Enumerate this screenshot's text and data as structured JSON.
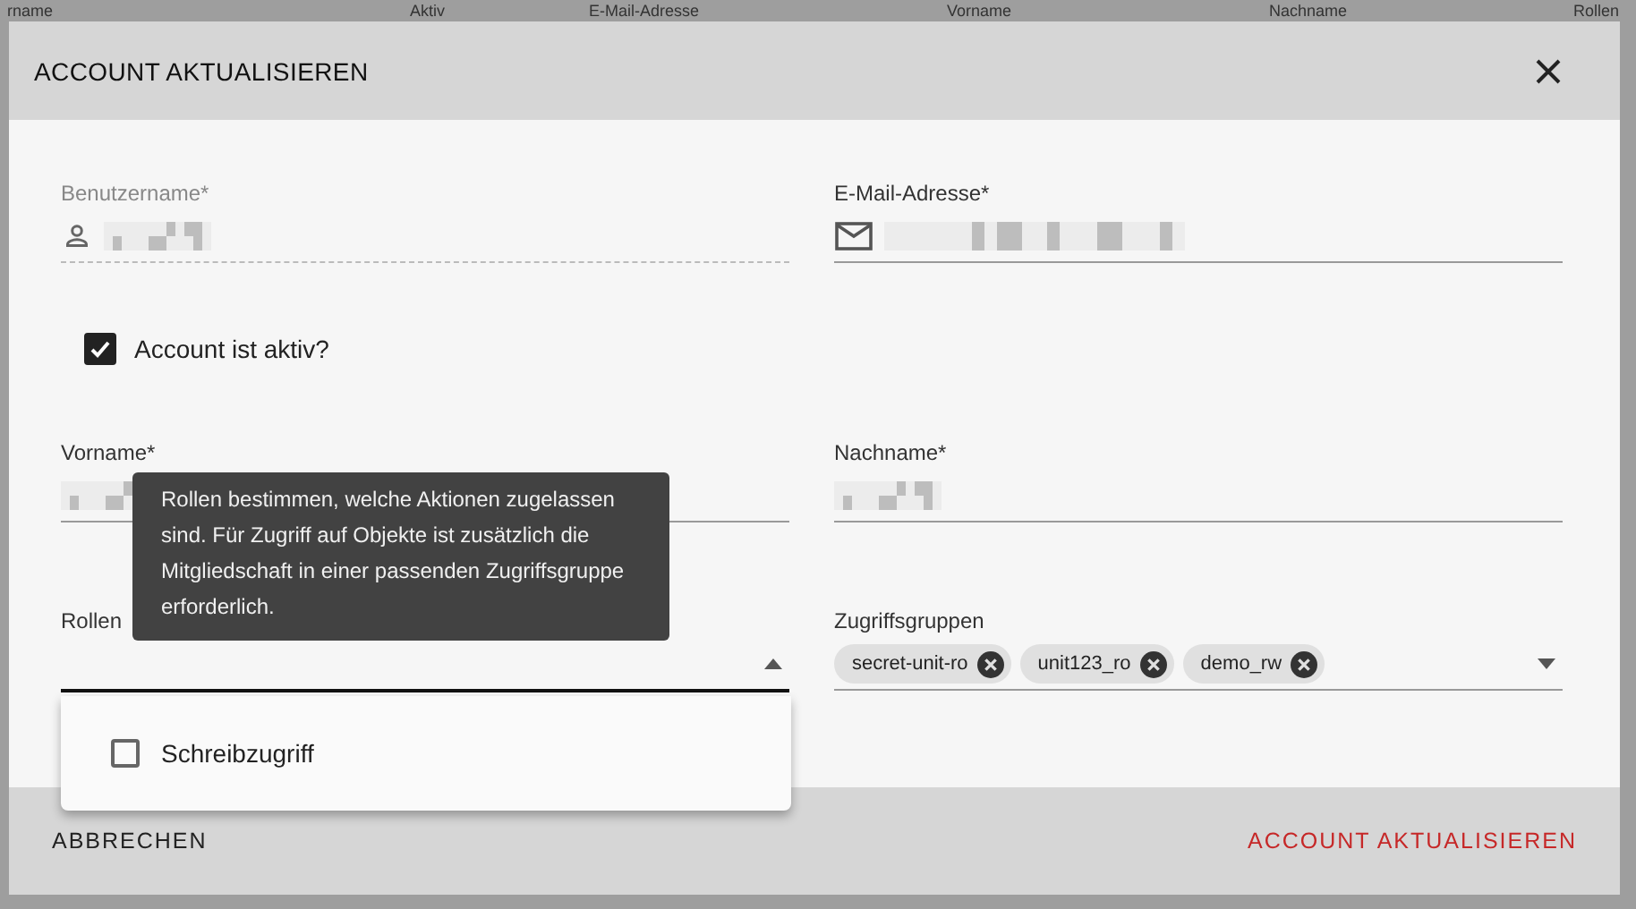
{
  "background_table": {
    "columns": [
      "rname",
      "Aktiv",
      "E-Mail-Adresse",
      "Vorname",
      "Nachname",
      "Rollen"
    ]
  },
  "dialog": {
    "title": "ACCOUNT AKTUALISIEREN",
    "rows": [
      {
        "fields": [
          {
            "kind": "user",
            "label": "Benutzername*",
            "disabled": true,
            "redacted": true
          },
          {
            "kind": "email",
            "label": "E-Mail-Adresse*",
            "disabled": false,
            "redacted": true
          }
        ]
      },
      {
        "checkbox": {
          "label": "Account ist aktiv?",
          "checked": true
        }
      },
      {
        "fields": [
          {
            "kind": "text",
            "label": "Vorname*",
            "disabled": false,
            "redacted": true
          },
          {
            "kind": "text",
            "label": "Nachname*",
            "disabled": false,
            "redacted": true
          }
        ]
      },
      {
        "fields": [
          {
            "kind": "select",
            "label": "Rollen",
            "disabled": false,
            "expanded": true
          },
          {
            "kind": "chips",
            "label": "Zugriffsgruppen",
            "disabled": false,
            "expanded": false,
            "chips": [
              "secret-unit-ro",
              "unit123_ro",
              "demo_rw"
            ]
          }
        ]
      }
    ],
    "tooltip": "Rollen bestimmen, welche Aktionen zugelassen sind. Für Zugriff auf Objekte ist zusätzlich die Mitgliedschaft in einer passenden Zugriffsgruppe erforderlich.",
    "menu": [
      {
        "label": "Schreibzugriff",
        "checked": false
      }
    ],
    "buttons": [
      {
        "kind": "cancel",
        "label": "ABBRECHEN"
      },
      {
        "kind": "submit",
        "label": "ACCOUNT AKTUALISIEREN"
      }
    ]
  }
}
